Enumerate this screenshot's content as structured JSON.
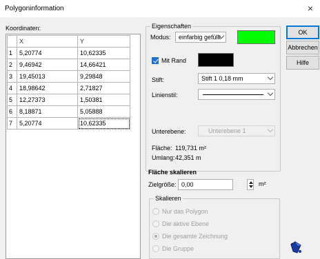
{
  "window": {
    "title": "Polygoninformation",
    "close_glyph": "×"
  },
  "coordinates": {
    "label": "Koordinaten:",
    "columns": [
      "X",
      "Y"
    ],
    "rows": [
      {
        "n": "1",
        "x": "5,20774",
        "y": "10,62335"
      },
      {
        "n": "2",
        "x": "9,46942",
        "y": "14,66421"
      },
      {
        "n": "3",
        "x": "19,45013",
        "y": "9,29848"
      },
      {
        "n": "4",
        "x": "18,98642",
        "y": "2,71827"
      },
      {
        "n": "5",
        "x": "12,27373",
        "y": "1,50381"
      },
      {
        "n": "6",
        "x": "8,18871",
        "y": "5,05888"
      },
      {
        "n": "7",
        "x": "5,20774",
        "y": "10,62335"
      }
    ]
  },
  "properties": {
    "legend": "Eigenschaften",
    "mode_label": "Modus:",
    "mode_value": "einfarbig gefüllt",
    "fill_color": "#00ff00",
    "border_checkbox_label": "Mit Rand",
    "border_checked": true,
    "border_color": "#000000",
    "pen_label": "Stift:",
    "pen_value": "Stift 1  0,18 mm",
    "linestyle_label": "Linienstil:",
    "sublevel_label": "Unterebene:",
    "sublevel_value": "Unterebene 1",
    "area_label": "Fläche:",
    "area_value": "119,731 m²",
    "perimeter_label": "Umlang:",
    "perimeter_value": "42,351 m"
  },
  "scale": {
    "heading": "Fläche skalieren",
    "target_label": "Zielgröße:",
    "target_value": "0,00",
    "unit": "m²",
    "group_legend": "Skalieren",
    "options": [
      {
        "label": "Nur das Polygon",
        "checked": false
      },
      {
        "label": "Die aktive Ebene",
        "checked": false
      },
      {
        "label": "Die gesamte Zeichnung",
        "checked": true
      },
      {
        "label": "Die Gruppe",
        "checked": false
      }
    ]
  },
  "buttons": {
    "ok": "OK",
    "cancel": "Abbrechen",
    "help": "Hilfe"
  },
  "icons": {
    "bucket": "paint-bucket-icon"
  }
}
